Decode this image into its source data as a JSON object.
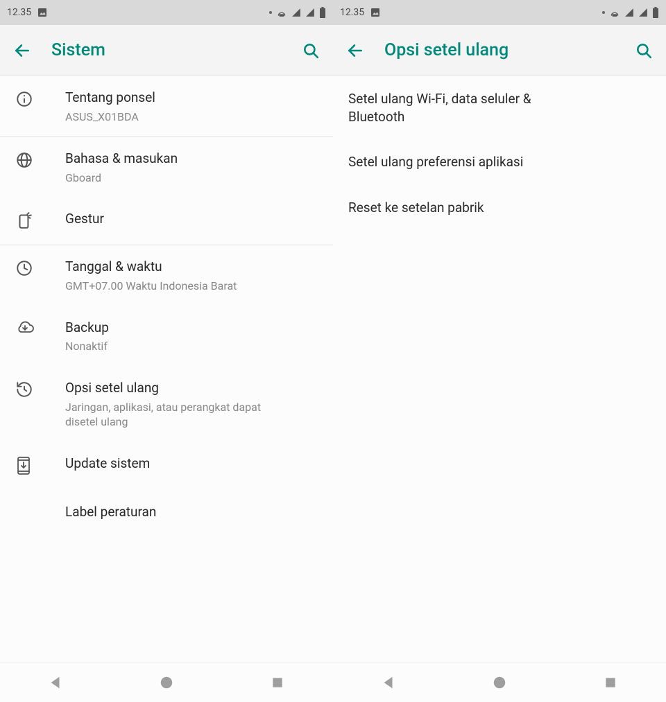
{
  "status": {
    "time": "12.35"
  },
  "left": {
    "title": "Sistem",
    "items": [
      {
        "icon": "info",
        "title": "Tentang ponsel",
        "sub": "ASUS_X01BDA"
      },
      {
        "icon": "globe",
        "title": "Bahasa & masukan",
        "sub": "Gboard"
      },
      {
        "icon": "gesture",
        "title": "Gestur",
        "sub": ""
      },
      {
        "icon": "clock",
        "title": "Tanggal & waktu",
        "sub": "GMT+07.00 Waktu Indonesia Barat"
      },
      {
        "icon": "cloud",
        "title": "Backup",
        "sub": "Nonaktif"
      },
      {
        "icon": "restore",
        "title": "Opsi setel ulang",
        "sub": "Jaringan, aplikasi, atau perangkat dapat disetel ulang"
      },
      {
        "icon": "update",
        "title": "Update sistem",
        "sub": ""
      },
      {
        "icon": "",
        "title": "Label peraturan",
        "sub": ""
      }
    ]
  },
  "right": {
    "title": "Opsi setel ulang",
    "items": [
      {
        "title": "Setel ulang Wi-Fi, data seluler & Bluetooth"
      },
      {
        "title": "Setel ulang preferensi aplikasi"
      },
      {
        "title": "Reset ke setelan pabrik"
      }
    ]
  }
}
